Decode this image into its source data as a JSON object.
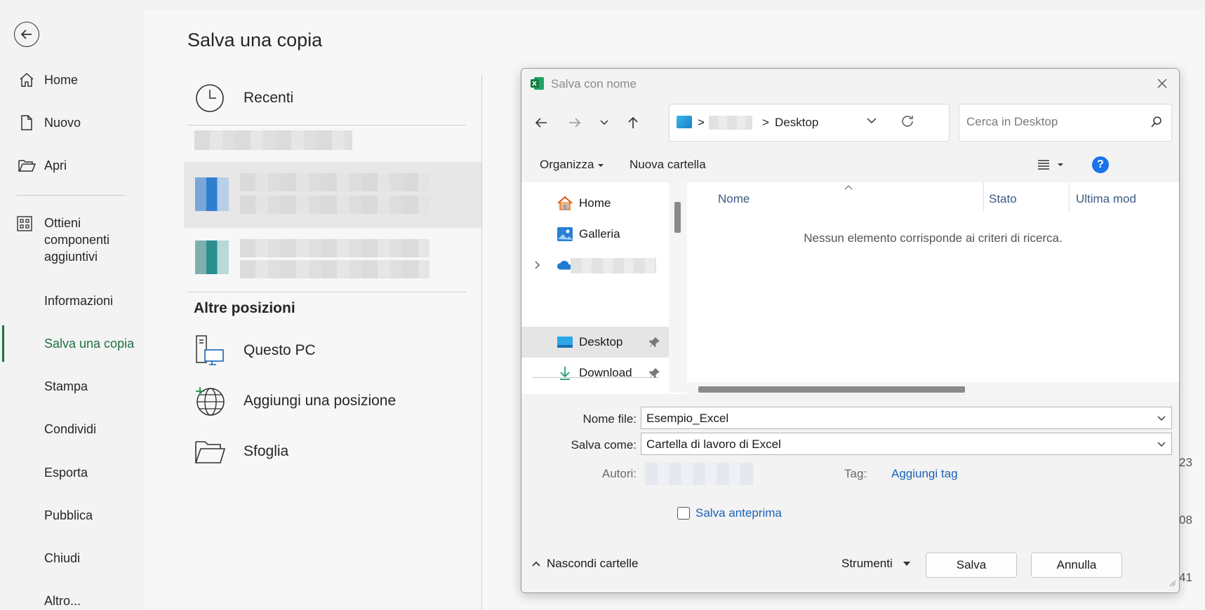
{
  "nav": {
    "back_label": "",
    "items": [
      {
        "label": "Home"
      },
      {
        "label": "Nuovo"
      },
      {
        "label": "Apri"
      }
    ],
    "addins_label": "Ottieni componenti aggiuntivi",
    "text_items": [
      {
        "label": "Informazioni"
      },
      {
        "label": "Salva una copia"
      },
      {
        "label": "Stampa"
      },
      {
        "label": "Condividi"
      },
      {
        "label": "Esporta"
      },
      {
        "label": "Pubblica"
      },
      {
        "label": "Chiudi"
      },
      {
        "label": "Altro..."
      }
    ],
    "active": "Salva una copia",
    "accent_color": "#1e7145"
  },
  "main": {
    "title": "Salva una copia",
    "recenti_label": "Recenti",
    "altre_posizioni_label": "Altre posizioni",
    "locations": [
      {
        "label": "Questo PC",
        "icon": "pc-icon"
      },
      {
        "label": "Aggiungi una posizione",
        "icon": "globe-add-icon"
      },
      {
        "label": "Sfoglia",
        "icon": "folder-open-icon"
      }
    ],
    "right_edge_numbers": [
      "23",
      "08",
      "41"
    ]
  },
  "dialog": {
    "title": "Salva con nome",
    "address": {
      "current": "Desktop",
      "separator": ">"
    },
    "search_placeholder": "Cerca in Desktop",
    "organize_label": "Organizza",
    "new_folder_label": "Nuova cartella",
    "tree": [
      {
        "label": "Home",
        "icon": "home-icon"
      },
      {
        "label": "Galleria",
        "icon": "gallery-icon"
      },
      {
        "label": "Desktop",
        "icon": "desktop-icon",
        "selected": true
      },
      {
        "label": "Download",
        "icon": "download-icon"
      }
    ],
    "columns": [
      "Nome",
      "Stato",
      "Ultima mod"
    ],
    "empty_message": "Nessun elemento corrisponde ai criteri di ricerca.",
    "file_name_label": "Nome file:",
    "file_name_value": "Esempio_Excel",
    "save_as_label": "Salva come:",
    "save_as_value": "Cartella di lavoro di Excel",
    "authors_label": "Autori:",
    "tags_label": "Tag:",
    "tags_link": "Aggiungi tag",
    "preview_label": "Salva anteprima",
    "hide_folders_label": "Nascondi cartelle",
    "tools_label": "Strumenti",
    "save_button": "Salva",
    "cancel_button": "Annulla",
    "help_color": "#1a73e8"
  }
}
